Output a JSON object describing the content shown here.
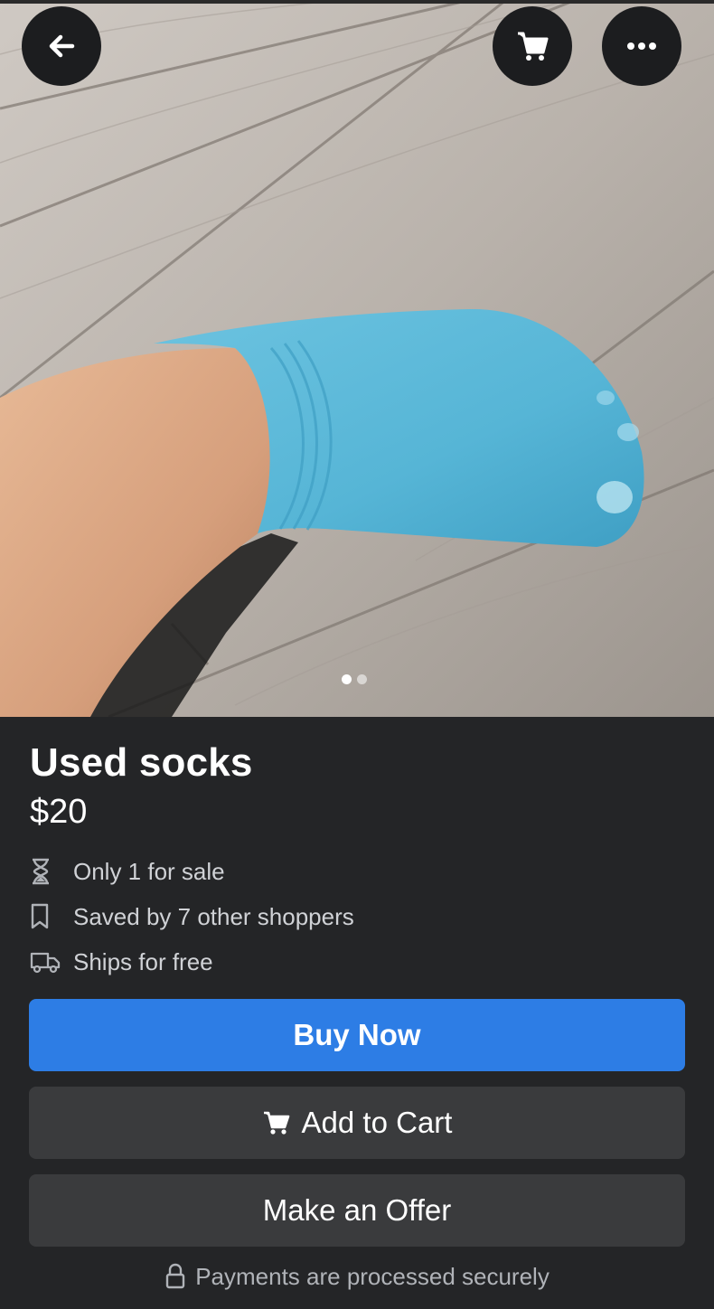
{
  "photo": {
    "description_icon": "product-photo-sock",
    "carousel_count": 2,
    "carousel_active_index": 0
  },
  "header": {
    "back_icon": "arrow-left-icon",
    "cart_icon": "cart-icon",
    "more_icon": "more-horizontal-icon"
  },
  "listing": {
    "title": "Used socks",
    "price": "$20",
    "details": [
      {
        "icon": "hourglass-icon",
        "text": "Only 1 for sale"
      },
      {
        "icon": "bookmark-icon",
        "text": "Saved by 7 other shoppers"
      },
      {
        "icon": "truck-icon",
        "text": "Ships for free"
      }
    ]
  },
  "actions": {
    "buy_now": "Buy Now",
    "add_to_cart": "Add to Cart",
    "make_offer": "Make an Offer"
  },
  "footer": {
    "secure_text": "Payments are processed securely"
  },
  "colors": {
    "background": "#242527",
    "primary": "#2d7de5",
    "secondary": "#3a3b3d",
    "sock": "#56b5d6"
  }
}
